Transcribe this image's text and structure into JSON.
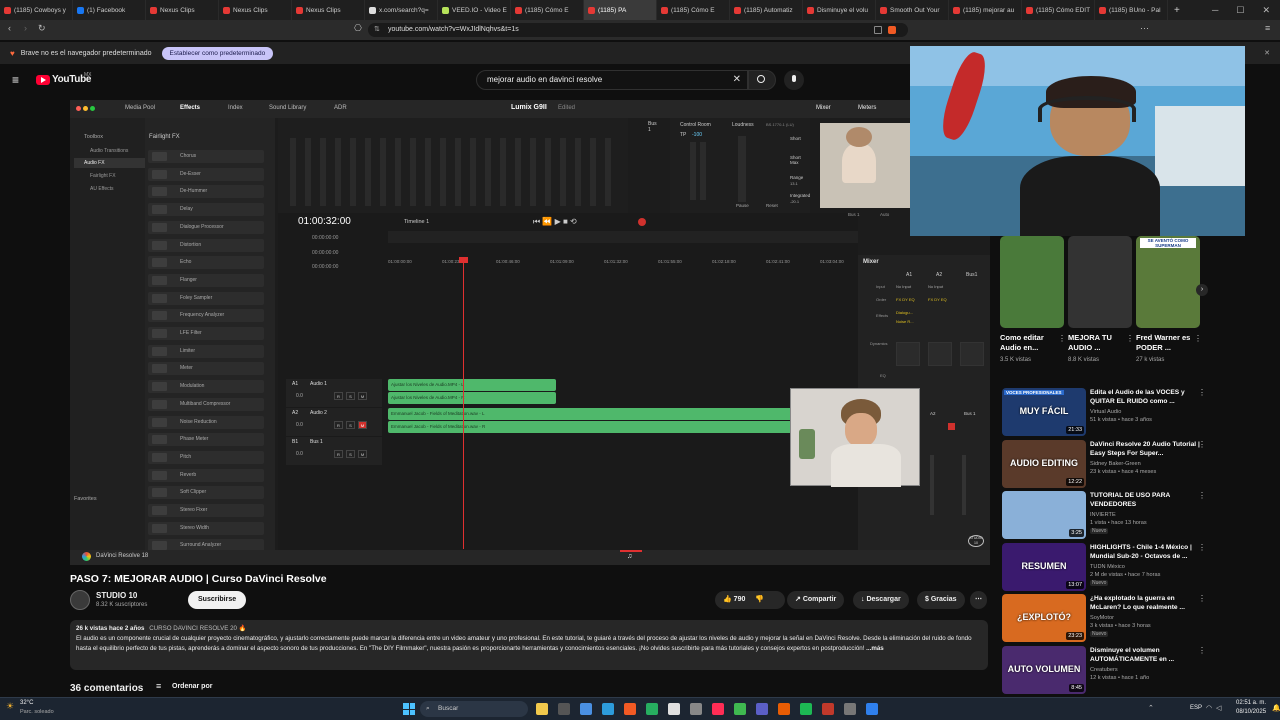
{
  "browser": {
    "tabs": [
      {
        "title": "(1185) Cowboys y",
        "color": "#e53935"
      },
      {
        "title": "(1) Facebook",
        "color": "#1877f2"
      },
      {
        "title": "Nexus Clips",
        "color": "#e53935"
      },
      {
        "title": "Nexus Clips",
        "color": "#e53935"
      },
      {
        "title": "Nexus Clips",
        "color": "#e53935"
      },
      {
        "title": "x.com/search?q=",
        "color": "#dddddd"
      },
      {
        "title": "VEED.IO - Video E",
        "color": "#b6e35a"
      },
      {
        "title": "(1185) Cómo E",
        "color": "#e53935"
      },
      {
        "title": "(1185) PA",
        "color": "#e53935",
        "active": true
      },
      {
        "title": "(1185) Cómo E",
        "color": "#e53935"
      },
      {
        "title": "(1185) Automatiz",
        "color": "#e53935"
      },
      {
        "title": "Disminuye el volu",
        "color": "#e53935"
      },
      {
        "title": "Smooth Out Your",
        "color": "#e53935"
      },
      {
        "title": "(1185) mejorar au",
        "color": "#e53935"
      },
      {
        "title": "(1185) Cómo EDIT",
        "color": "#e53935"
      },
      {
        "title": "(1185) BUno - Pal",
        "color": "#e53935"
      }
    ],
    "url": "youtube.com/watch?v=WxJIdlNqhvs&t=1s",
    "infobar_text": "Brave no es el navegador predeterminado",
    "infobar_button": "Establecer como predeterminado"
  },
  "youtube": {
    "logo": "YouTube",
    "logo_sup": "MX",
    "search_value": "mejorar audio en davinci resolve"
  },
  "davinci": {
    "tabs": [
      "Media Pool",
      "Effects",
      "Index",
      "Sound Library",
      "ADR"
    ],
    "project": "Lumix G9II",
    "edited": "Edited",
    "right_tabs": [
      "Mixer",
      "Meters"
    ],
    "toolbox": "Toolbox",
    "sidebar_items": [
      "Audio Transitions",
      "Audio FX",
      "Fairlight FX",
      "AU Effects"
    ],
    "favorites": "Favorites",
    "fx_header": "Fairlight FX",
    "fx_items": [
      "Chorus",
      "De-Esser",
      "De-Hummer",
      "Delay",
      "Dialogue Processor",
      "Distortion",
      "Echo",
      "Flanger",
      "Foley Sampler",
      "Frequency Analyzer",
      "LFE Filter",
      "Limiter",
      "Meter",
      "Modulation",
      "Multiband Compressor",
      "Noise Reduction",
      "Phase Meter",
      "Pitch",
      "Reverb",
      "Soft Clipper",
      "Stereo Fixer",
      "Stereo Width",
      "Surround Analyzer"
    ],
    "timecode": "01:00:32:00",
    "timeline_name": "Timeline 1",
    "ruler": [
      "01:00:00:00",
      "01:00:23:00",
      "01:00:46:00",
      "01:01:09:00",
      "01:01:32:00",
      "01:01:55:00",
      "01:02:18:00",
      "01:02:41:00",
      "01:03:04:00"
    ],
    "timecodes": [
      "00:00:00:00",
      "00:00:00:00",
      "00:00:00:00"
    ],
    "tracks": [
      {
        "id": "A1",
        "name": "Audio 1",
        "level": "0.0"
      },
      {
        "id": "A2",
        "name": "Audio 2",
        "level": "0.0"
      },
      {
        "id": "B1",
        "name": "Bus 1",
        "level": "0.0"
      }
    ],
    "clips": [
      "Ajustar los Niveles de Audio.MP4 - L",
      "Ajustar los Niveles de Audio.MP4 - R",
      "Emmanuel Jacob - Fields of Meditation.wav - L",
      "Emmanuel Jacob - Fields of Meditation.wav - R"
    ],
    "mixer_title": "Mixer",
    "mixer_channels": [
      "A1",
      "A2",
      "Bus1"
    ],
    "mixer_rows": [
      "Input",
      "Order",
      "Effects",
      "Dynamics",
      "EQ"
    ],
    "mixer_values": [
      "No Input",
      "No Input",
      "FX DY EQ",
      "FX DY EQ",
      "Dialogu...",
      "Noise R..."
    ],
    "loudness": "Loudness",
    "loudness_val": "BS.1770-1 (LU)",
    "control_room": "Control Room",
    "tp_label": "TP",
    "tp_val": "-100",
    "meter_labels": [
      "Short",
      "Short Max",
      "Range",
      "Integrated"
    ],
    "meter_values": [
      "13.1",
      "-20.1"
    ],
    "pause": "Pause",
    "reset": "Reset",
    "bus": "Bus 1",
    "bus_auto": [
      "Bus 1",
      "Auto"
    ],
    "mixer_bottom": [
      "A2",
      "Bus 1"
    ],
    "app_name": "DaVinci Resolve 18"
  },
  "video": {
    "title": "PASO 7: MEJORAR AUDIO | Curso DaVinci Resolve",
    "channel": "STUDIO 10",
    "subscribers": "8.32 K suscriptores",
    "subscribe": "Suscribirse",
    "likes": "790",
    "share": "Compartir",
    "download": "Descargar",
    "thanks": "Gracias",
    "stats": "26 k vistas  hace 2 años",
    "hashtag": "CURSO DAVINCI RESOLVE 20 🔥",
    "description": "El audio es un componente crucial de cualquier proyecto cinematográfico, y ajustarlo correctamente puede marcar la diferencia entre un video amateur y uno profesional. En este tutorial, te guiaré a través del proceso de ajustar los niveles de audio y mejorar la señal en DaVinci Resolve. Desde la eliminación del ruido de fondo hasta el equilibrio perfecto de tus pistas, aprenderás a dominar el aspecto sonoro de tus producciones. En \"The DIY Filmmaker\", nuestra pasión es proporcionarte herramientas y conocimientos esenciales. ¡No olvides suscribirte para más tutoriales y consejos expertos en postproducción!",
    "more": "...más",
    "comments": "36 comentarios",
    "sort": "Ordenar por",
    "watermark": "STUDIO 10"
  },
  "shorts": [
    {
      "title": "Como editar Audio en...",
      "views": "3.5 K vistas",
      "color": "#4a7a3a"
    },
    {
      "title": "MEJORA TU AUDIO ...",
      "views": "8.8 K vistas",
      "color": "#333333"
    },
    {
      "title": "Fred Warner es PODER ...",
      "views": "27 k vistas",
      "color": "#5a7a3a",
      "overlay": "SE AVENTÓ COMO SUPERMAN"
    }
  ],
  "videos": [
    {
      "title": "Edita el Audio de las VOCES y QUITAR EL RUIDO como ...",
      "channel": "Virtual Audio",
      "meta": "51 k vistas • hace 3 años",
      "duration": "21:33",
      "thumb_text": "MUY FÁCIL",
      "tag": "VOCES PROFESIONALES",
      "color": "#1e3a6e"
    },
    {
      "title": "DaVinci Resolve 20 Audio Tutorial | Easy Steps For Super...",
      "channel": "Sidney Baker-Green",
      "meta": "23 k vistas • hace 4 meses",
      "duration": "12:22",
      "thumb_text": "AUDIO EDITING",
      "color": "#5a3a2a"
    },
    {
      "title": "TUTORIAL DE USO PARA VENDEDORES",
      "channel": "INVIERTE",
      "meta": "1 vista • hace 13 horas",
      "duration": "3:25",
      "badge": "Nuevo",
      "color": "#8ab0d8"
    },
    {
      "title": "HIGHLIGHTS - Chile 1-4 México | Mundial Sub-20 - Octavos de ...",
      "channel": "TUDN México",
      "meta": "2 M de vistas • hace 7 horas",
      "duration": "13:07",
      "thumb_text": "RESUMEN",
      "badge": "Nuevo",
      "color": "#3a1a6e"
    },
    {
      "title": "¿Ha explotado la guerra en McLaren? Lo que realmente ...",
      "channel": "SoyMotor",
      "meta": "3 k vistas • hace 3 horas",
      "duration": "23:23",
      "thumb_text": "¿EXPLOTÓ?",
      "badge": "Nuevo",
      "color": "#d86a20"
    },
    {
      "title": "Disminuye el volumen AUTOMÁTICAMENTE en ...",
      "channel": "Creatubers",
      "meta": "12 k vistas • hace 1 año",
      "duration": "8:45",
      "thumb_text": "AUTO VOLUMEN",
      "color": "#4a2a6e"
    }
  ],
  "taskbar": {
    "weather_temp": "32°C",
    "weather_desc": "Parc. soleado",
    "search": "Buscar",
    "lang": "ESP",
    "time": "02:51 a. m.",
    "date": "08/10/2025"
  }
}
